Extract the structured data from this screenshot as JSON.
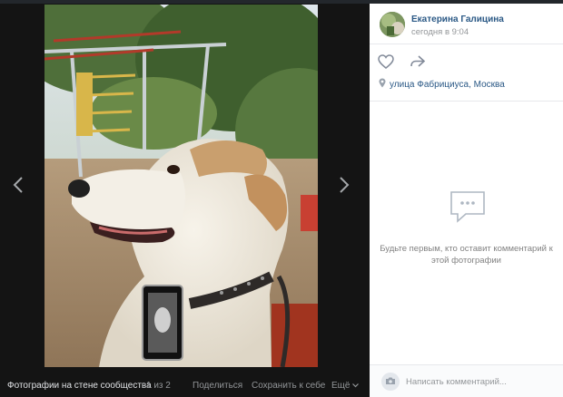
{
  "viewer": {
    "album_label": "Фотографии на стене сообщества",
    "counter": "1 из 2",
    "share_label": "Поделиться",
    "save_label": "Сохранить к себе",
    "more_label": "Ещё"
  },
  "post": {
    "author_name": "Екатерина Галицина",
    "time": "сегодня в 9:04",
    "location": "улица Фабрициуса, Москва"
  },
  "comments": {
    "empty_text": "Будьте первым, кто оставит комментарий к этой фотографии",
    "input_placeholder": "Написать комментарий..."
  },
  "icons": {
    "prev": "chevron-left-icon",
    "next": "chevron-right-icon",
    "like": "heart-icon",
    "share": "share-arrow-icon",
    "location": "location-pin-icon",
    "comments_empty": "comment-bubble-icon",
    "camera": "camera-icon",
    "more": "chevron-down-icon"
  },
  "colors": {
    "link": "#2a5885",
    "viewer_bg": "#141414",
    "muted": "#939699"
  }
}
